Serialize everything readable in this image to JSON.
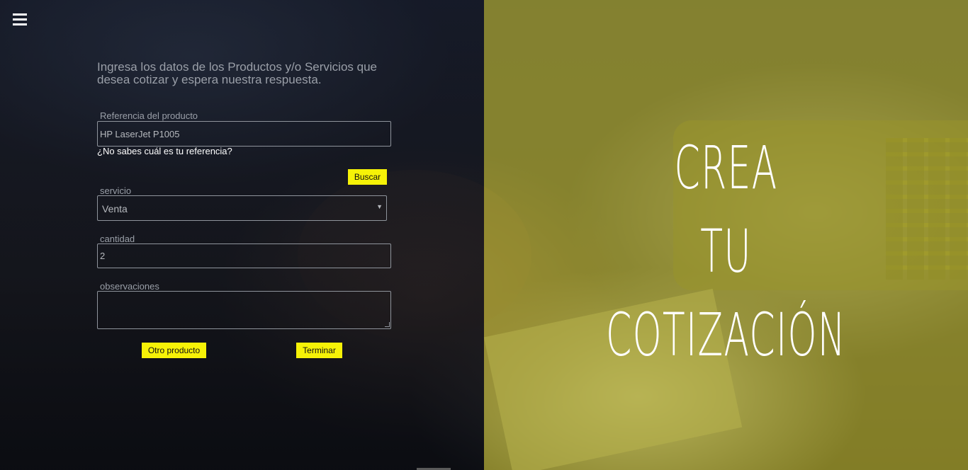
{
  "nav": {
    "menu_icon": "hamburger-icon"
  },
  "form": {
    "intro": "Ingresa los datos de los Productos y/o Servicios que desea cotizar y espera nuestra respuesta.",
    "reference": {
      "label": "Referencia del producto",
      "value": "HP LaserJet P1005"
    },
    "hint_link": "¿No sabes cuál es tu referencia?",
    "search_button": "Buscar",
    "service": {
      "label": "servicio",
      "selected": "Venta",
      "arrow_icon": "caret-down-icon"
    },
    "quantity": {
      "label": "cantidad",
      "value": "2"
    },
    "observations": {
      "label": "observaciones",
      "value": ""
    },
    "add_product_button": "Otro producto",
    "finish_button": "Terminar"
  },
  "hero": {
    "line1": "CREA",
    "line2": "TU",
    "line3": "COTIZACIÓN"
  },
  "colors": {
    "button_yellow": "#f6f207",
    "overlay_olive": "#a5a028"
  }
}
